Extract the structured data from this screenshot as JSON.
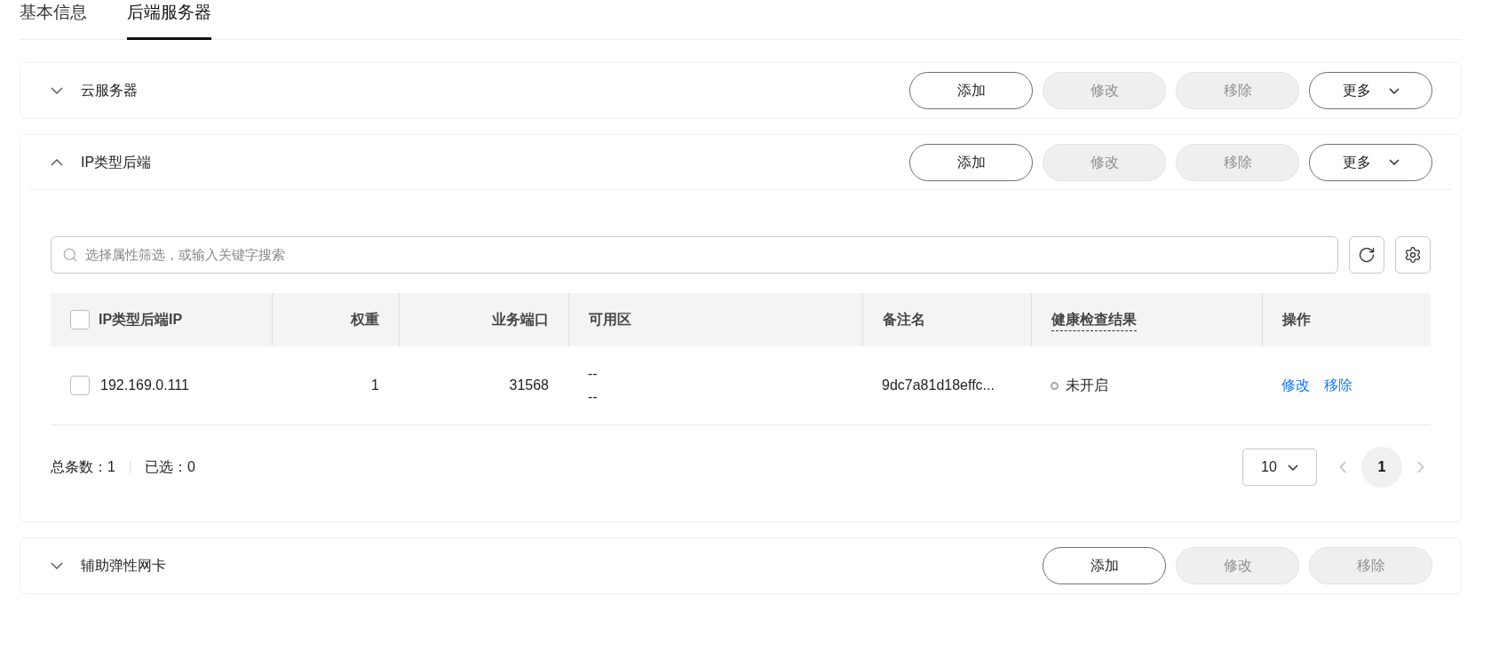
{
  "tabs": [
    {
      "label": "基本信息",
      "selected": false
    },
    {
      "label": "后端服务器",
      "selected": true
    }
  ],
  "sections": [
    {
      "title": "云服务器",
      "expanded": false,
      "buttons": [
        {
          "label": "添加",
          "kind": "button",
          "disabled": false
        },
        {
          "label": "修改",
          "kind": "button",
          "disabled": true
        },
        {
          "label": "移除",
          "kind": "button",
          "disabled": true
        },
        {
          "label": "更多",
          "kind": "dropdown",
          "disabled": false
        }
      ]
    },
    {
      "title": "IP类型后端",
      "expanded": true,
      "buttons": [
        {
          "label": "添加",
          "kind": "button",
          "disabled": false
        },
        {
          "label": "修改",
          "kind": "button",
          "disabled": true
        },
        {
          "label": "移除",
          "kind": "button",
          "disabled": true
        },
        {
          "label": "更多",
          "kind": "dropdown",
          "disabled": false
        }
      ],
      "content": {
        "search": {
          "placeholder": "选择属性筛选，或输入关键字搜索"
        },
        "table": {
          "select_all_checked": false,
          "columns": [
            {
              "label": "IP类型后端IP",
              "dotted": false
            },
            {
              "label": "权重",
              "dotted": false
            },
            {
              "label": "业务端口",
              "dotted": false
            },
            {
              "label": "可用区",
              "dotted": false
            },
            {
              "label": "备注名",
              "dotted": false
            },
            {
              "label": "健康检查结果",
              "dotted": true
            },
            {
              "label": "操作",
              "dotted": false
            }
          ],
          "rows": [
            {
              "checked": false,
              "ip": "192.169.0.111",
              "weight": "1",
              "port": "31568",
              "zone": [
                "--",
                "--"
              ],
              "remark": "9dc7a81d18effc...",
              "health": "未开启",
              "actions": [
                "修改",
                "移除"
              ]
            }
          ]
        },
        "footer": {
          "total": "总条数：1",
          "selected": "已选：0"
        },
        "pagination": {
          "page_size": "10",
          "pages": [
            {
              "label": "1",
              "selected": true
            }
          ]
        }
      }
    },
    {
      "title": "辅助弹性网卡",
      "expanded": false,
      "buttons": [
        {
          "label": "添加",
          "kind": "button",
          "disabled": false
        },
        {
          "label": "修改",
          "kind": "button",
          "disabled": true
        },
        {
          "label": "移除",
          "kind": "button",
          "disabled": true
        }
      ]
    }
  ]
}
